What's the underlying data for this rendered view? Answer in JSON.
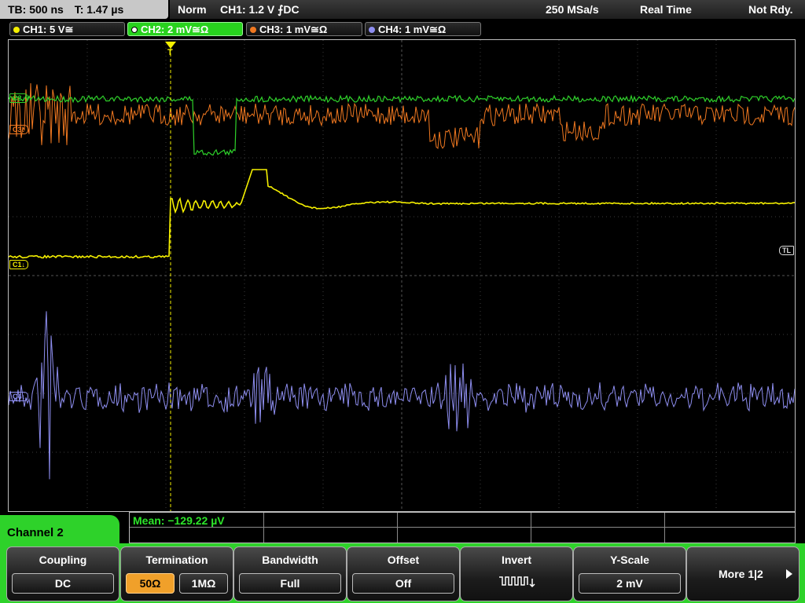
{
  "status": {
    "timebase": "TB: 500 ns",
    "trigger_time": "T: 1.47 µs",
    "mode": "Norm",
    "trigger_info": "CH1: 1.2 V ⨍DC",
    "sample_rate": "250 MSa/s",
    "acq_mode": "Real Time",
    "ready_state": "Not Rdy."
  },
  "channels": [
    {
      "label": "CH1: 5 V≅",
      "color": "#f5f000"
    },
    {
      "label": "CH2: 2 mV≅Ω",
      "color": "#2ed22a"
    },
    {
      "label": "CH3: 1 mV≅Ω",
      "color": "#f07820"
    },
    {
      "label": "CH4: 1 mV≅Ω",
      "color": "#8e8ef0"
    }
  ],
  "markers": {
    "c3": "C3↓",
    "c1": "C1↓",
    "c2": "C2↓",
    "c4": "C4↓",
    "tl": "TL",
    "trigger": "T"
  },
  "measurement": {
    "text": "Mean: −129.22 µV"
  },
  "panel": {
    "title": "Channel 2"
  },
  "softkeys": {
    "coupling": {
      "title": "Coupling",
      "value": "DC"
    },
    "termination": {
      "title": "Termination",
      "opt1": "50Ω",
      "opt2": "1MΩ"
    },
    "bandwidth": {
      "title": "Bandwidth",
      "value": "Full"
    },
    "offset": {
      "title": "Offset",
      "value": "Off"
    },
    "invert": {
      "title": "Invert"
    },
    "yscale": {
      "title": "Y-Scale",
      "value": "2 mV"
    },
    "more": {
      "label": "More 1|2"
    }
  }
}
